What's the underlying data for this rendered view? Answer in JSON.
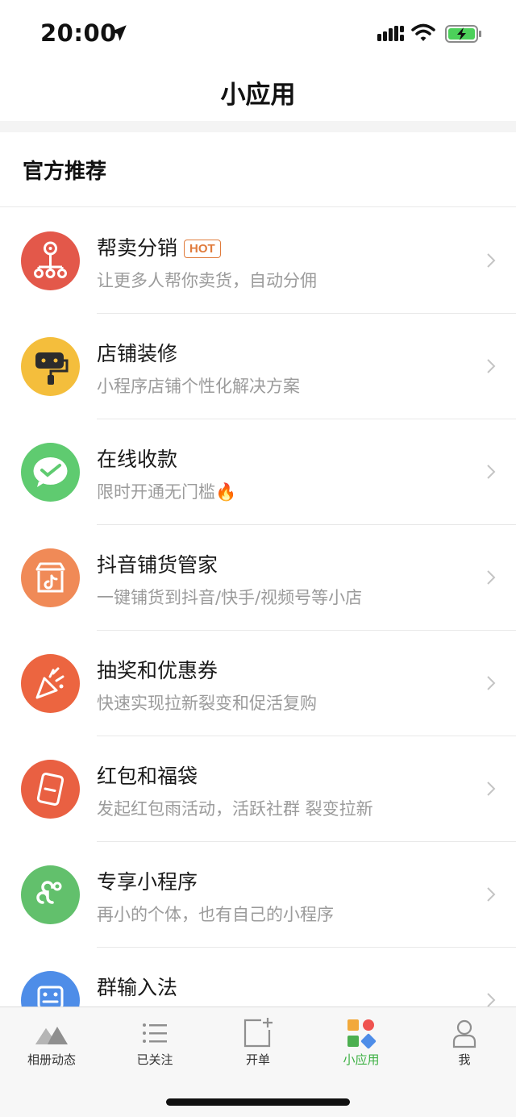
{
  "status_bar": {
    "time": "20:00"
  },
  "nav": {
    "title": "小应用"
  },
  "section": {
    "title": "官方推荐"
  },
  "apps": [
    {
      "name": "帮卖分销",
      "badge": "HOT",
      "desc": "让更多人帮你卖货，自动分佣",
      "color": "#e3584a",
      "icon": "distribution-icon"
    },
    {
      "name": "店铺装修",
      "badge": "",
      "desc": "小程序店铺个性化解决方案",
      "color": "#f4be3c",
      "icon": "paint-roller-icon"
    },
    {
      "name": "在线收款",
      "badge": "",
      "desc": "限时开通无门槛🔥",
      "color": "#5fcb70",
      "icon": "checkmark-icon"
    },
    {
      "name": "抖音铺货管家",
      "badge": "",
      "desc": "一键铺货到抖音/快手/视频号等小店",
      "color": "#f08a57",
      "icon": "shop-tiktok-icon"
    },
    {
      "name": "抽奖和优惠券",
      "badge": "",
      "desc": "快速实现拉新裂变和促活复购",
      "color": "#ec6540",
      "icon": "party-popper-icon"
    },
    {
      "name": "红包和福袋",
      "badge": "",
      "desc": "发起红包雨活动，活跃社群 裂变拉新",
      "color": "#e96042",
      "icon": "red-envelope-icon"
    },
    {
      "name": "专享小程序",
      "badge": "",
      "desc": "再小的个体，也有自己的小程序",
      "color": "#62c06c",
      "icon": "mini-program-icon"
    },
    {
      "name": "群输入法",
      "badge": "",
      "desc": "",
      "color": "#4e8de8",
      "icon": "keyboard-icon"
    }
  ],
  "tabs": [
    {
      "label": "相册动态",
      "icon": "mountain-icon",
      "active": false
    },
    {
      "label": "已关注",
      "icon": "list-icon",
      "active": false
    },
    {
      "label": "开单",
      "icon": "new-order-icon",
      "active": false
    },
    {
      "label": "小应用",
      "icon": "apps-icon",
      "active": true
    },
    {
      "label": "我",
      "icon": "person-icon",
      "active": false
    }
  ],
  "colors": {
    "accent": "#3cb043",
    "badge": "#e07b3c"
  }
}
